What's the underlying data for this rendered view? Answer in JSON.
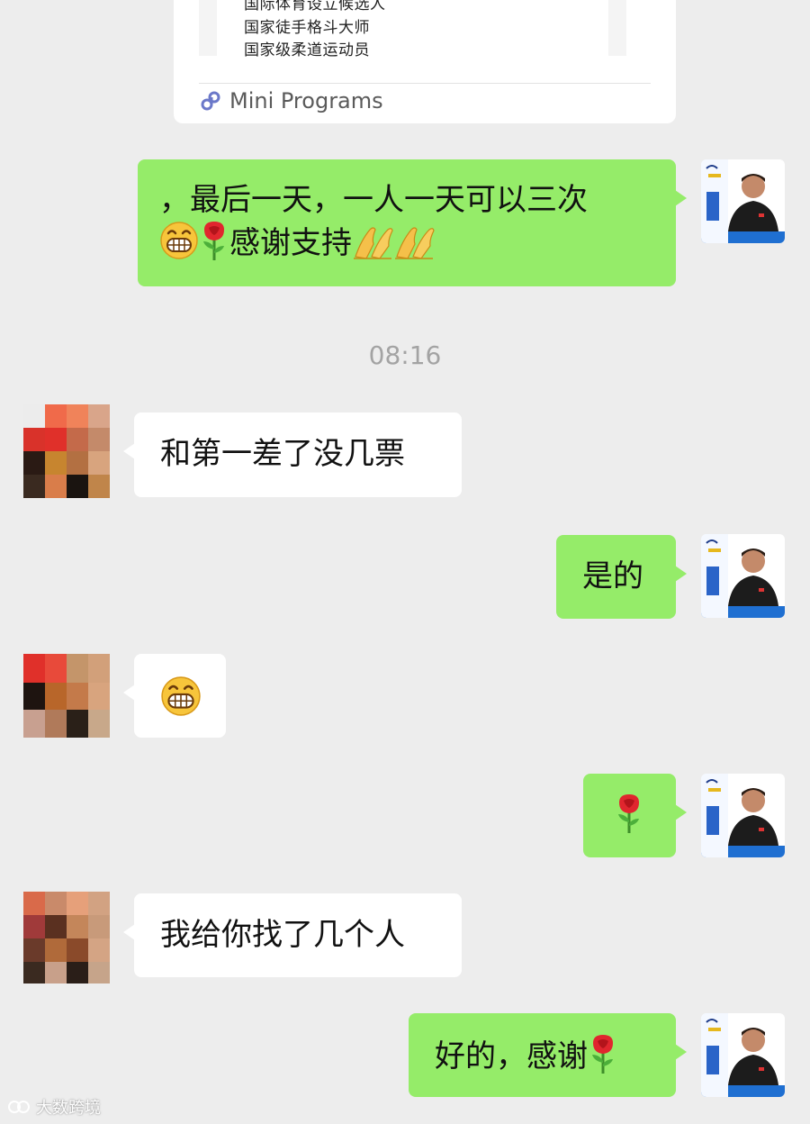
{
  "mini_program_card": {
    "lines": [
      "国际体育设立候选人",
      "国家徒手格斗大师",
      "国家级柔道运动员"
    ],
    "footer_label": "Mini Programs",
    "icon": "mini-program-icon"
  },
  "messages": [
    {
      "side": "right",
      "text_line1": "，最后一天，一人一天可以三次",
      "text_line2": "感谢支持",
      "emojis": [
        "grin",
        "rose",
        "pray",
        "pray"
      ]
    },
    {
      "side": "left",
      "text": "和第一差了没几票"
    },
    {
      "side": "right",
      "text": "是的"
    },
    {
      "side": "left",
      "emoji": "grin"
    },
    {
      "side": "right",
      "emoji": "rose"
    },
    {
      "side": "left",
      "text": "我给你找了几个人"
    },
    {
      "side": "right",
      "text": "好的，感谢",
      "emojis": [
        "rose"
      ]
    }
  ],
  "timestamp": "08:16",
  "colors": {
    "background": "#ededed",
    "sent_bubble": "#95ec69",
    "received_bubble": "#ffffff"
  },
  "watermark": "大数跨境"
}
